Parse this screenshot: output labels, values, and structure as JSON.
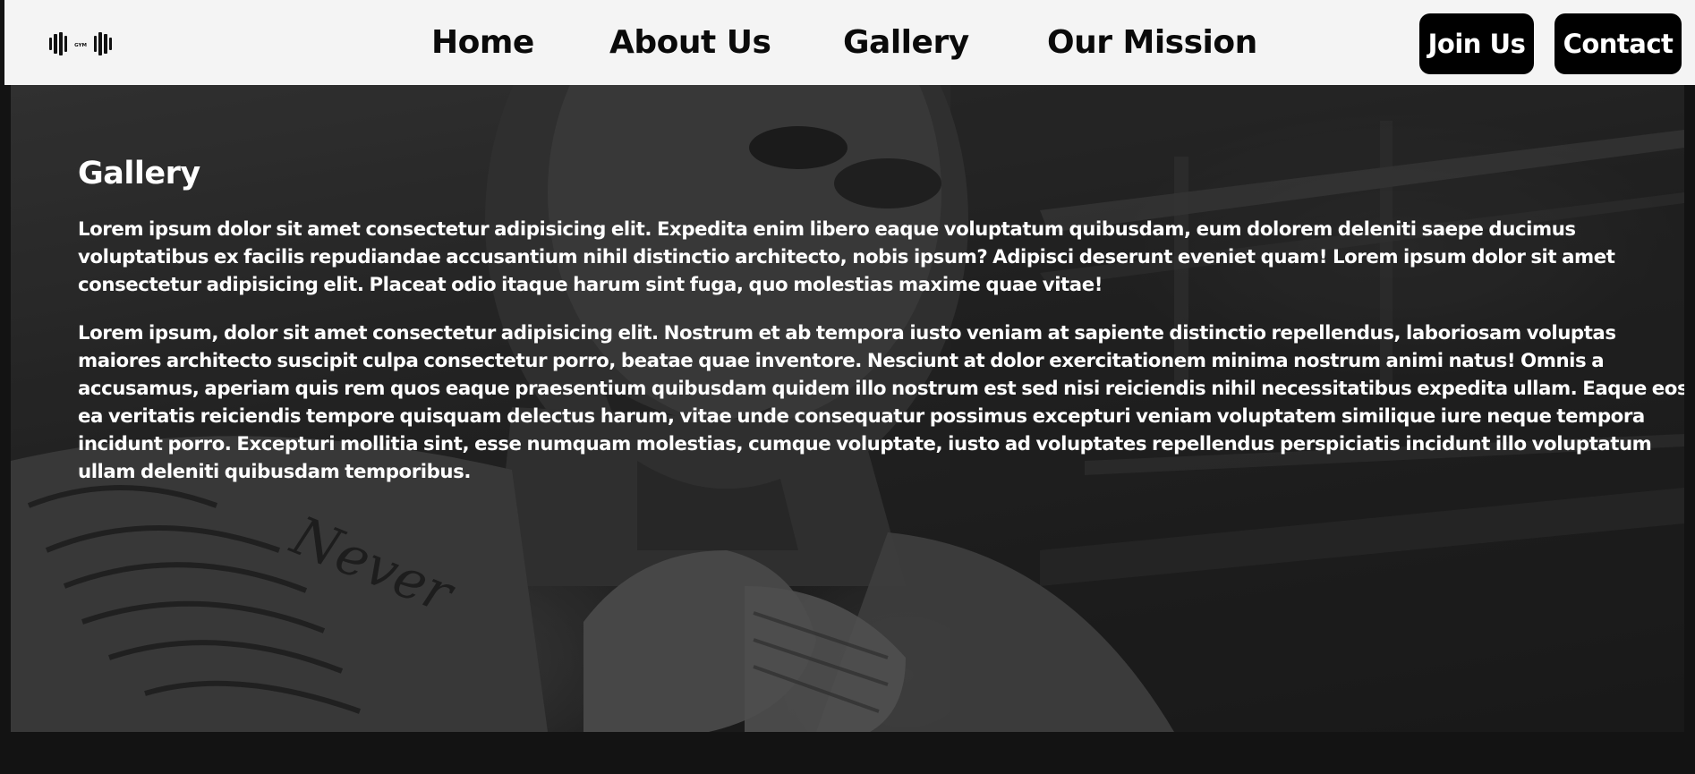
{
  "brand": {
    "logo_text": "GYM"
  },
  "nav": {
    "items": [
      {
        "label": "Home"
      },
      {
        "label": "About Us"
      },
      {
        "label": "Gallery"
      },
      {
        "label": "Our Mission"
      }
    ]
  },
  "actions": {
    "join_label": "Join Us",
    "contact_label": "Contact"
  },
  "hero": {
    "title": "Gallery",
    "paragraphs": [
      "Lorem ipsum dolor sit amet consectetur adipisicing elit. Expedita enim libero eaque voluptatum quibusdam, eum dolorem deleniti saepe ducimus voluptatibus ex facilis repudiandae accusantium nihil distinctio architecto, nobis ipsum? Adipisci deserunt eveniet quam! Lorem ipsum dolor sit amet consectetur adipisicing elit. Placeat odio itaque harum sint fuga, quo molestias maxime quae vitae!",
      "Lorem ipsum, dolor sit amet consectetur adipisicing elit. Nostrum et ab tempora iusto veniam at sapiente distinctio repellendus, laboriosam voluptas maiores architecto suscipit culpa consectetur porro, beatae quae inventore. Nesciunt at dolor exercitationem minima nostrum animi natus! Omnis a accusamus, aperiam quis rem quos eaque praesentium quibusdam quidem illo nostrum est sed nisi reiciendis nihil necessitatibus expedita ullam. Eaque eos ea veritatis reiciendis tempore quisquam delectus harum, vitae unde consequatur possimus excepturi veniam voluptatem similique iure neque tempora incidunt porro. Excepturi mollitia sint, esse numquam molestias, cumque voluptate, iusto ad voluptates repellendus perspiciatis incidunt illo voluptatum ullam deleniti quibusdam temporibus."
    ],
    "tattoo_text": "Never"
  },
  "colors": {
    "header_bg": "#f4f4f4",
    "nav_text": "#0a0a0a",
    "button_bg": "#000000",
    "button_text": "#ffffff",
    "page_bg": "#131313",
    "hero_text": "#ffffff"
  },
  "icons": {
    "logo": "dumbbell-icon"
  }
}
